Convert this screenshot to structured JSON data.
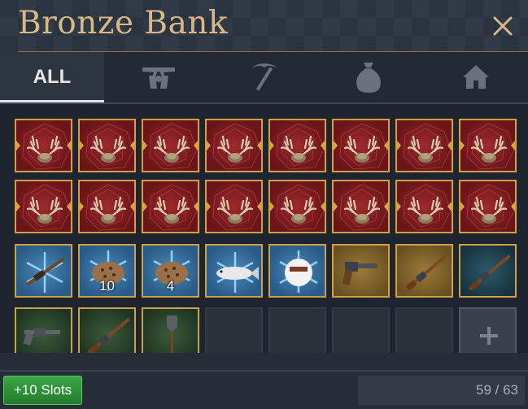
{
  "window": {
    "title": "Bronze Bank"
  },
  "tabs": [
    {
      "label": "ALL",
      "icon": "",
      "active": true
    },
    {
      "label": "",
      "icon": "crossed-revolvers-icon",
      "active": false
    },
    {
      "label": "",
      "icon": "pickaxe-icon",
      "active": false
    },
    {
      "label": "",
      "icon": "money-bag-icon",
      "active": false
    },
    {
      "label": "",
      "icon": "house-icon",
      "active": false
    }
  ],
  "items": [
    {
      "icon": "antler-trophy-icon",
      "bg": "red",
      "qty": ""
    },
    {
      "icon": "antler-trophy-icon",
      "bg": "red",
      "qty": ""
    },
    {
      "icon": "antler-trophy-icon",
      "bg": "red",
      "qty": ""
    },
    {
      "icon": "antler-trophy-icon",
      "bg": "red",
      "qty": ""
    },
    {
      "icon": "antler-trophy-icon",
      "bg": "red",
      "qty": ""
    },
    {
      "icon": "antler-trophy-icon",
      "bg": "red",
      "qty": ""
    },
    {
      "icon": "antler-trophy-icon",
      "bg": "red",
      "qty": ""
    },
    {
      "icon": "antler-trophy-icon",
      "bg": "red",
      "qty": ""
    },
    {
      "icon": "antler-trophy-icon",
      "bg": "red",
      "qty": ""
    },
    {
      "icon": "antler-trophy-icon",
      "bg": "red",
      "qty": ""
    },
    {
      "icon": "antler-trophy-icon",
      "bg": "red",
      "qty": ""
    },
    {
      "icon": "antler-trophy-icon",
      "bg": "red",
      "qty": ""
    },
    {
      "icon": "antler-trophy-icon",
      "bg": "red",
      "qty": ""
    },
    {
      "icon": "antler-trophy-icon",
      "bg": "red",
      "qty": ""
    },
    {
      "icon": "antler-trophy-icon",
      "bg": "red",
      "qty": ""
    },
    {
      "icon": "antler-trophy-icon",
      "bg": "red",
      "qty": ""
    },
    {
      "icon": "frost-rifle-icon",
      "bg": "blue",
      "qty": ""
    },
    {
      "icon": "frost-cookie-icon",
      "bg": "blue",
      "qty": "10"
    },
    {
      "icon": "frost-cookie-icon",
      "bg": "blue",
      "qty": "4"
    },
    {
      "icon": "frost-fish-icon",
      "bg": "blue",
      "qty": ""
    },
    {
      "icon": "snowball-icon",
      "bg": "blue",
      "qty": ""
    },
    {
      "icon": "pistol-icon",
      "bg": "gold",
      "qty": ""
    },
    {
      "icon": "rifle-icon",
      "bg": "gold",
      "qty": ""
    },
    {
      "icon": "rifle-icon",
      "bg": "teal",
      "qty": ""
    },
    {
      "icon": "revolver-icon",
      "bg": "green",
      "qty": ""
    },
    {
      "icon": "rifle-icon",
      "bg": "green",
      "qty": ""
    },
    {
      "icon": "shovel-icon",
      "bg": "green",
      "qty": ""
    },
    {
      "icon": "",
      "bg": "empty",
      "qty": ""
    },
    {
      "icon": "",
      "bg": "empty",
      "qty": ""
    },
    {
      "icon": "",
      "bg": "empty",
      "qty": ""
    },
    {
      "icon": "",
      "bg": "empty",
      "qty": ""
    },
    {
      "icon": "plus-icon",
      "bg": "add",
      "qty": ""
    }
  ],
  "footer": {
    "add_slots_label": "+10 Slots",
    "capacity": "59 / 63"
  },
  "colors": {
    "title": "#d8b887",
    "slot_border": "#c9a24a",
    "add_button": "#2e9238"
  }
}
